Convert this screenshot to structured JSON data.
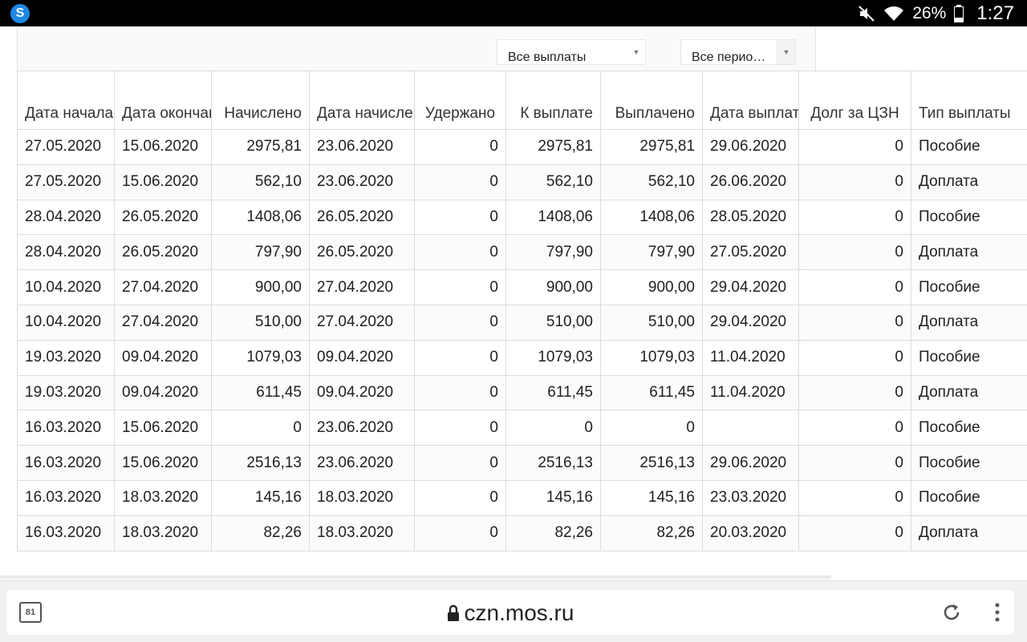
{
  "status_bar": {
    "battery_percent": "26%",
    "time": "1:27",
    "app_icon_letter": "S"
  },
  "filters": {
    "payments_select": "Все выплаты",
    "period_select": "Все перио…"
  },
  "table": {
    "headers": [
      "Дата начала",
      "Дата окончание",
      "Начислено",
      "Дата начисления",
      "Удержано",
      "К выплате",
      "Выплачено",
      "Дата выплаты",
      "Долг за ЦЗН",
      "Тип выплаты"
    ],
    "rows": [
      [
        "27.05.2020",
        "15.06.2020",
        "2975,81",
        "23.06.2020",
        "0",
        "2975,81",
        "2975,81",
        "29.06.2020",
        "0",
        "Пособие"
      ],
      [
        "27.05.2020",
        "15.06.2020",
        "562,10",
        "23.06.2020",
        "0",
        "562,10",
        "562,10",
        "26.06.2020",
        "0",
        "Доплата"
      ],
      [
        "28.04.2020",
        "26.05.2020",
        "1408,06",
        "26.05.2020",
        "0",
        "1408,06",
        "1408,06",
        "28.05.2020",
        "0",
        "Пособие"
      ],
      [
        "28.04.2020",
        "26.05.2020",
        "797,90",
        "26.05.2020",
        "0",
        "797,90",
        "797,90",
        "27.05.2020",
        "0",
        "Доплата"
      ],
      [
        "10.04.2020",
        "27.04.2020",
        "900,00",
        "27.04.2020",
        "0",
        "900,00",
        "900,00",
        "29.04.2020",
        "0",
        "Пособие"
      ],
      [
        "10.04.2020",
        "27.04.2020",
        "510,00",
        "27.04.2020",
        "0",
        "510,00",
        "510,00",
        "29.04.2020",
        "0",
        "Доплата"
      ],
      [
        "19.03.2020",
        "09.04.2020",
        "1079,03",
        "09.04.2020",
        "0",
        "1079,03",
        "1079,03",
        "11.04.2020",
        "0",
        "Пособие"
      ],
      [
        "19.03.2020",
        "09.04.2020",
        "611,45",
        "09.04.2020",
        "0",
        "611,45",
        "611,45",
        "11.04.2020",
        "0",
        "Доплата"
      ],
      [
        "16.03.2020",
        "15.06.2020",
        "0",
        "23.06.2020",
        "0",
        "0",
        "0",
        "",
        "0",
        "Пособие"
      ],
      [
        "16.03.2020",
        "15.06.2020",
        "2516,13",
        "23.06.2020",
        "0",
        "2516,13",
        "2516,13",
        "29.06.2020",
        "0",
        "Пособие"
      ],
      [
        "16.03.2020",
        "18.03.2020",
        "145,16",
        "18.03.2020",
        "0",
        "145,16",
        "145,16",
        "23.03.2020",
        "0",
        "Пособие"
      ],
      [
        "16.03.2020",
        "18.03.2020",
        "82,26",
        "18.03.2020",
        "0",
        "82,26",
        "82,26",
        "20.03.2020",
        "0",
        "Доплата"
      ]
    ]
  },
  "browser": {
    "tab_count": "81",
    "url": "czn.mos.ru"
  },
  "icons": [
    "skype-icon",
    "mute-icon",
    "wifi-icon",
    "battery-icon",
    "lock-icon",
    "reload-icon",
    "overflow-menu-icon",
    "tabs-icon"
  ]
}
